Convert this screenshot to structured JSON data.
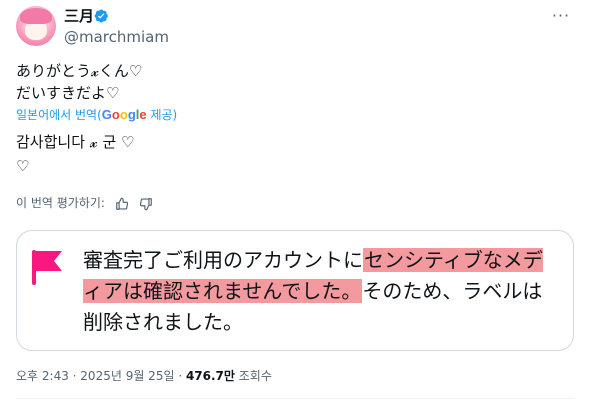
{
  "author": {
    "display_name": "三月",
    "handle": "@marchmiam",
    "verified": true,
    "verified_color": "#1d9bf0"
  },
  "menu": {
    "more_icon": "more-horizontal-icon",
    "more_glyph": "···"
  },
  "tweet": {
    "text": "ありがとう𝔁くん♡\nだいすきだよ♡",
    "translation_prefix": "일본어에서 번역(",
    "translation_brand": [
      "G",
      "o",
      "o",
      "g",
      "l",
      "e"
    ],
    "translation_suffix": "제공)",
    "translated_text": "감사합니다 𝔁 군 ♡\n♡",
    "rate_label": "이 번역 평가하기:",
    "rate_icons": [
      "thumbs-up-icon",
      "thumbs-down-icon"
    ]
  },
  "notice_card": {
    "flag_icon": "flag-icon",
    "flag_color": "#f91880",
    "highlight_color": "#f4999e",
    "part1": "審査完了ご利用のアカウントに",
    "highlight": "センシティブなメディアは確認されませんでした。",
    "part2": "そのため、ラベルは削除されました。"
  },
  "meta": {
    "time": "오후 2:43",
    "sep1": " · ",
    "date": "2025년 9월 25일",
    "sep2": " · ",
    "views": "476.7만",
    "views_label": " 조회수"
  }
}
